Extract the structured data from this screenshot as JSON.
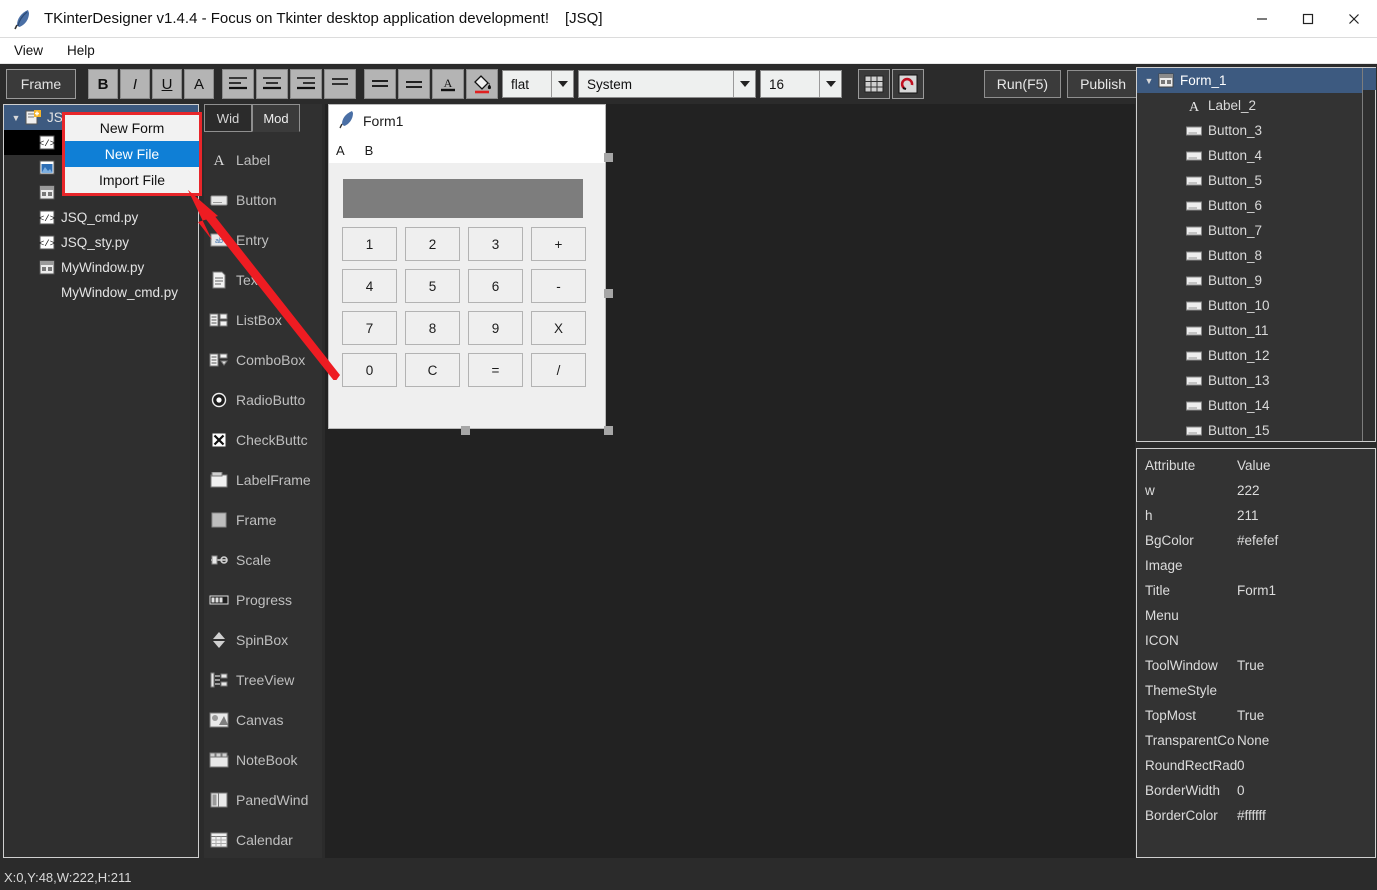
{
  "window": {
    "icon": "feather-icon",
    "title": "TKinterDesigner v1.4.4 - Focus on Tkinter desktop application development!",
    "project_tag": "[JSQ]",
    "minimize": "minimize-icon",
    "maximize": "maximize-icon",
    "close": "close-icon"
  },
  "menubar": {
    "items": [
      {
        "label": "View"
      },
      {
        "label": "Help"
      }
    ]
  },
  "toolbar": {
    "widget_type": "Frame",
    "bold": "B",
    "italic": "I",
    "underline": "U",
    "font_a": "A",
    "align_left": "align-left-icon",
    "align_center": "align-center-icon",
    "align_right": "align-right-icon",
    "align_justify": "align-justify-icon",
    "align_top": "align-top-icon",
    "align_bottom": "align-bottom-icon",
    "font_color": "A",
    "fill_color": "paint-bucket-icon",
    "relief": "flat",
    "font_family": "System",
    "font_size": "16",
    "grid": "grid-icon",
    "magnet": "magnet-icon",
    "run": "Run(F5)",
    "publish": "Publish"
  },
  "project_tree": {
    "root": {
      "label": "JSQ",
      "icon": "project-icon",
      "expanded": true
    },
    "items": [
      {
        "label": "",
        "icon": "code-file-icon",
        "selected": true
      },
      {
        "label": "",
        "icon": "image-file-icon",
        "selected": false
      },
      {
        "label": "",
        "icon": "window-file-icon",
        "selected": false
      },
      {
        "label": "JSQ_cmd.py",
        "icon": "code-file-icon",
        "selected": false
      },
      {
        "label": "JSQ_sty.py",
        "icon": "code-file-icon",
        "selected": false
      },
      {
        "label": "MyWindow.py",
        "icon": "window-file-icon",
        "selected": false
      },
      {
        "label": "MyWindow_cmd.py",
        "icon": "none",
        "selected": false
      }
    ]
  },
  "context_menu": {
    "items": [
      {
        "label": "New Form",
        "highlighted": false
      },
      {
        "label": "New File",
        "highlighted": true
      },
      {
        "label": "Import File",
        "highlighted": false
      }
    ]
  },
  "palette": {
    "tabs": [
      {
        "label": "Wid",
        "active": true
      },
      {
        "label": "Mod",
        "active": false
      }
    ],
    "items": [
      {
        "label": "Label",
        "icon": "label-icon"
      },
      {
        "label": "Button",
        "icon": "button-icon"
      },
      {
        "label": "Entry",
        "icon": "entry-icon"
      },
      {
        "label": "Text",
        "icon": "text-icon"
      },
      {
        "label": "ListBox",
        "icon": "listbox-icon"
      },
      {
        "label": "ComboBox",
        "icon": "combobox-icon"
      },
      {
        "label": "RadioButto",
        "icon": "radiobutton-icon"
      },
      {
        "label": "CheckButtc",
        "icon": "checkbutton-icon"
      },
      {
        "label": "LabelFrame",
        "icon": "labelframe-icon"
      },
      {
        "label": "Frame",
        "icon": "frame-icon"
      },
      {
        "label": "Scale",
        "icon": "scale-icon"
      },
      {
        "label": "Progress",
        "icon": "progress-icon"
      },
      {
        "label": "SpinBox",
        "icon": "spinbox-icon"
      },
      {
        "label": "TreeView",
        "icon": "treeview-icon"
      },
      {
        "label": "Canvas",
        "icon": "canvas-icon"
      },
      {
        "label": "NoteBook",
        "icon": "notebook-icon"
      },
      {
        "label": "PanedWind",
        "icon": "panedwindow-icon"
      },
      {
        "label": "Calendar",
        "icon": "calendar-icon"
      }
    ]
  },
  "form_designer": {
    "icon": "feather-icon",
    "title": "Form1",
    "menu": [
      {
        "label": "A"
      },
      {
        "label": "B"
      }
    ],
    "display_value": "",
    "buttons": [
      "1",
      "2",
      "3",
      "+",
      "4",
      "5",
      "6",
      "-",
      "7",
      "8",
      "9",
      "X",
      "0",
      "C",
      "=",
      "/"
    ]
  },
  "object_tree": {
    "root": {
      "label": "Form_1",
      "icon": "form-icon",
      "expanded": true
    },
    "items": [
      {
        "label": "Label_2",
        "icon": "label-icon"
      },
      {
        "label": "Button_3",
        "icon": "button-icon"
      },
      {
        "label": "Button_4",
        "icon": "button-icon"
      },
      {
        "label": "Button_5",
        "icon": "button-icon"
      },
      {
        "label": "Button_6",
        "icon": "button-icon"
      },
      {
        "label": "Button_7",
        "icon": "button-icon"
      },
      {
        "label": "Button_8",
        "icon": "button-icon"
      },
      {
        "label": "Button_9",
        "icon": "button-icon"
      },
      {
        "label": "Button_10",
        "icon": "button-icon"
      },
      {
        "label": "Button_11",
        "icon": "button-icon"
      },
      {
        "label": "Button_12",
        "icon": "button-icon"
      },
      {
        "label": "Button_13",
        "icon": "button-icon"
      },
      {
        "label": "Button_14",
        "icon": "button-icon"
      },
      {
        "label": "Button_15",
        "icon": "button-icon"
      }
    ]
  },
  "properties": {
    "headers": {
      "attribute": "Attribute",
      "value": "Value"
    },
    "rows": [
      {
        "attribute": "w",
        "value": "222"
      },
      {
        "attribute": "h",
        "value": "211"
      },
      {
        "attribute": "BgColor",
        "value": "#efefef"
      },
      {
        "attribute": "Image",
        "value": ""
      },
      {
        "attribute": "Title",
        "value": "Form1"
      },
      {
        "attribute": "Menu",
        "value": ""
      },
      {
        "attribute": "ICON",
        "value": ""
      },
      {
        "attribute": "ToolWindow",
        "value": "True"
      },
      {
        "attribute": "ThemeStyle",
        "value": ""
      },
      {
        "attribute": "TopMost",
        "value": "True"
      },
      {
        "attribute": "TransparentCo",
        "value": "None"
      },
      {
        "attribute": "RoundRectRad",
        "value": "0"
      },
      {
        "attribute": "BorderWidth",
        "value": "0"
      },
      {
        "attribute": "BorderColor",
        "value": "#ffffff"
      }
    ]
  },
  "status_bar": {
    "text": "X:0,Y:48,W:222,H:211"
  },
  "colors": {
    "app_bg": "#2b2b2b",
    "canvas_bg": "#222222",
    "panel_bg": "#333333",
    "selection_blue": "#3d5a80",
    "menu_highlight": "#0f7fd6",
    "annotation_red": "#e8262a",
    "form_bg": "#efefef"
  }
}
